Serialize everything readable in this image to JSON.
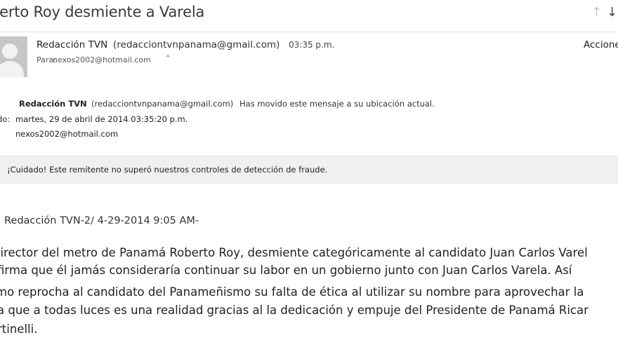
{
  "header": {
    "subject": "berto Roy desmiente a Varela",
    "actions_label": "Accione"
  },
  "sender": {
    "name": "Redacción TVN",
    "email": "(redacciontvnpanama@gmail.com)",
    "time": "03:35 p.m.",
    "to_label": "Para:",
    "to_address": "nexos2002@hotmail.com",
    "to_chevron": "⌃"
  },
  "details": {
    "from_name": "Redacción TVN",
    "from_email": "(redacciontvnpanama@gmail.com)",
    "moved_note": "Has movido este mensaje a su ubicación actual.",
    "sent_label": "do:",
    "sent_date": "martes, 29 de abril de 2014 03:35:20 p.m.",
    "to_address": "nexos2002@hotmail.com"
  },
  "warning": {
    "text": "¡Cuidado! Este remitente no superó nuestros controles de detección de fraude."
  },
  "body": {
    "byline": "Redacción TVN-2/ 4-29-2014 9:05 AM-",
    "lines": [
      "director del metro de Panamá Roberto Roy, desmiente categóricamente al candidato Juan Carlos Varel",
      "firma que él jamás consideraría continuar su labor en un gobierno junto con Juan Carlos Varela. Así",
      "mo reprocha al candidato del Panameñismo su falta de ética al utilizar su nombre para aprovechar la",
      "a que a todas luces es una realidad gracias al la dedicación y empuje del Presidente de Panamá Ricar",
      "rtinelli."
    ]
  },
  "icons": {
    "arrow_up": "↑",
    "arrow_down": "↓"
  }
}
